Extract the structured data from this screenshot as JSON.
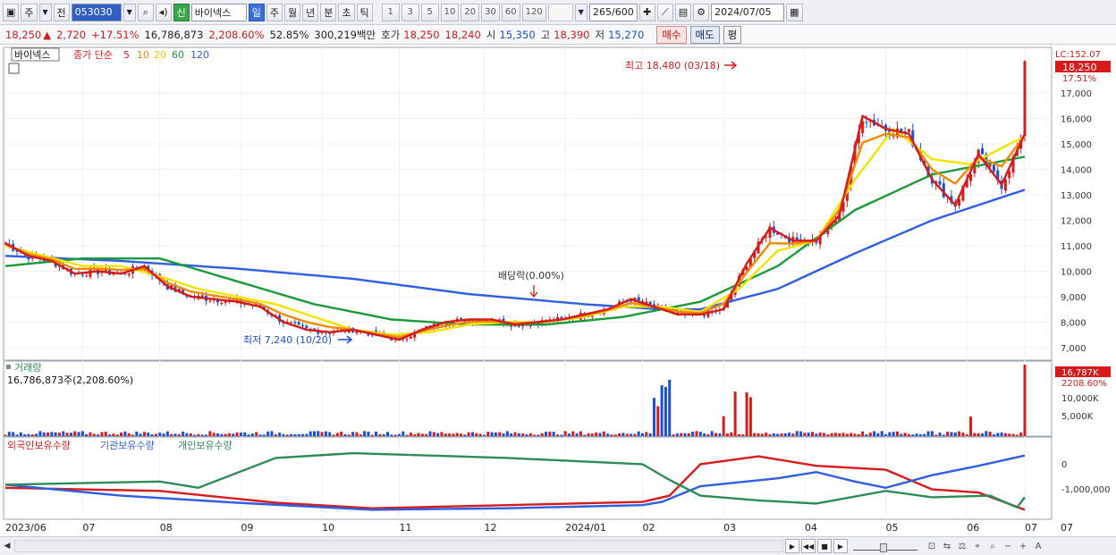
{
  "toolbar": {
    "stock_type": "주",
    "prev_label": "전",
    "code": "053030",
    "stock_badge": "신",
    "stock_name": "바이넥스",
    "periods": [
      "일",
      "주",
      "월",
      "년",
      "분",
      "초",
      "틱"
    ],
    "active_period": "일",
    "intervals": [
      "1",
      "3",
      "5",
      "10",
      "20",
      "30",
      "60",
      "120"
    ],
    "count": "265",
    "count_total": "/600",
    "date": "2024/07/05"
  },
  "quote": {
    "price": "18,250",
    "change_arrow": "▲",
    "change": "2,720",
    "change_pct": "+17.51%",
    "volume": "16,786,873",
    "volume_pct": "2,208.60%",
    "turnover_pct": "52.85%",
    "amount": "300,219백만",
    "ask_label": "호가",
    "ask": "18,250",
    "bid": "18,240",
    "open_label": "시",
    "open": "15,350",
    "high_label": "고",
    "high": "18,390",
    "low_label": "저",
    "low": "15,270",
    "buy_label": "매수",
    "sell_label": "매도",
    "avg_label": "평"
  },
  "chart_data": [
    {
      "type": "line",
      "title": "바이넥스",
      "legend": {
        "label": "종가 단순",
        "periods": [
          "5",
          "10",
          "20",
          "60",
          "120"
        ],
        "colors": [
          "#d71b1b",
          "#f08a00",
          "#f2e300",
          "#1a9a3a",
          "#2f5ee3"
        ]
      },
      "x_ticks": [
        "2023/06",
        "07",
        "08",
        "09",
        "10",
        "11",
        "12",
        "2024/01",
        "02",
        "03",
        "04",
        "05",
        "06",
        "07"
      ],
      "y_ticks": [
        "7,000",
        "8,000",
        "9,000",
        "10,000",
        "11,000",
        "12,000",
        "13,000",
        "14,000",
        "15,000",
        "16,000",
        "17,000"
      ],
      "ylim": [
        6500,
        18800
      ],
      "lc_label": "LC:152.07",
      "last_price_label": "18,250",
      "last_pct_label": "17.51%",
      "annotations": {
        "high": "최고 18,480 (03/18)",
        "low": "최저 7,240 (10/20)",
        "dividend": "배당락(0.00%)"
      },
      "series": [
        {
          "name": "5",
          "x": [
            0,
            6,
            12,
            18,
            24,
            30,
            36,
            42,
            48,
            54,
            60,
            66,
            72,
            78,
            84,
            90,
            96,
            102,
            108,
            114,
            120,
            126,
            132,
            138,
            144,
            150,
            156,
            162,
            168,
            174,
            180,
            186,
            192,
            198,
            204,
            210,
            216,
            222,
            228,
            234,
            240,
            246,
            252,
            258,
            264
          ],
          "values": [
            11100,
            10600,
            10400,
            9900,
            10000,
            9900,
            10200,
            9400,
            9000,
            8900,
            8800,
            8600,
            8000,
            7700,
            7600,
            7700,
            7500,
            7300,
            7700,
            8000,
            8100,
            8100,
            7900,
            8000,
            8100,
            8300,
            8500,
            8900,
            8600,
            8300,
            8300,
            8500,
            10300,
            11700,
            11200,
            11200,
            12200,
            16100,
            15600,
            15400,
            13600,
            12600,
            14600,
            13400,
            15400
          ]
        },
        {
          "name": "20",
          "x": [
            0,
            10,
            20,
            30,
            40,
            50,
            60,
            70,
            80,
            90,
            100,
            110,
            120,
            130,
            140,
            150,
            160,
            170,
            180,
            190,
            200,
            210,
            220,
            230,
            240,
            250,
            260,
            264
          ],
          "values": [
            11000,
            10600,
            10200,
            10200,
            9800,
            9300,
            9000,
            8700,
            8200,
            7700,
            7500,
            7600,
            7900,
            8000,
            8000,
            8200,
            8600,
            8600,
            8400,
            9300,
            10800,
            11200,
            13600,
            15600,
            14400,
            14200,
            15000,
            15300
          ]
        },
        {
          "name": "60",
          "x": [
            0,
            20,
            40,
            60,
            80,
            100,
            120,
            140,
            160,
            180,
            200,
            220,
            240,
            264
          ],
          "values": [
            10200,
            10500,
            10500,
            9600,
            8700,
            8100,
            7900,
            7900,
            8200,
            8800,
            10200,
            12400,
            13800,
            14500
          ]
        },
        {
          "name": "120",
          "x": [
            0,
            30,
            60,
            90,
            120,
            150,
            170,
            180,
            200,
            220,
            240,
            264
          ],
          "values": [
            10600,
            10400,
            10100,
            9700,
            9100,
            8700,
            8500,
            8500,
            9300,
            10700,
            12000,
            13200
          ]
        }
      ]
    },
    {
      "type": "bar",
      "title": "거래량",
      "value_label": "16,786,873주(2,208.60%)",
      "y_ticks": [
        "5,000K",
        "10,000K"
      ],
      "last_label": "16,787K",
      "last_pct_label": "2208.60%"
    },
    {
      "type": "line",
      "legend": [
        "외국인보유수량",
        "기관보유수량",
        "개인보유수량"
      ],
      "legend_colors": [
        "#d71b1b",
        "#2f5ee3",
        "#2e8b57"
      ],
      "y_ticks": [
        "0",
        "-1,000,000"
      ]
    }
  ],
  "colors": {
    "up": "#d71b1b",
    "down": "#1b4fd8",
    "accent": "#2f5fc4"
  }
}
